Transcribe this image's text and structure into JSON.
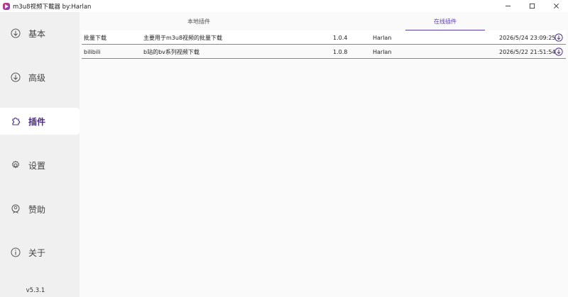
{
  "window": {
    "title": "m3u8视频下載器 by:Harlan",
    "controls": [
      "minimize-icon",
      "maximize-icon",
      "close-icon"
    ]
  },
  "sidebar": {
    "items": [
      {
        "label": "基本",
        "icon": "download-circle-icon",
        "active": false
      },
      {
        "label": "高级",
        "icon": "download-circle-icon",
        "active": false
      },
      {
        "label": "插件",
        "icon": "plugin-icon",
        "active": true
      },
      {
        "label": "设置",
        "icon": "gear-icon",
        "active": false
      },
      {
        "label": "赞助",
        "icon": "sponsor-icon",
        "active": false
      },
      {
        "label": "关于",
        "icon": "info-icon",
        "active": false
      }
    ],
    "version": "v5.3.1"
  },
  "tabs": [
    {
      "label": "本地插件",
      "active": false
    },
    {
      "label": "在线插件",
      "active": true
    }
  ],
  "plugins": [
    {
      "name": "批量下载",
      "description": "主要用于m3u8视频的批量下载",
      "version": "1.0.4",
      "author": "Harlan",
      "date": "2026/5/24 23:09:25",
      "icon": "download-icon"
    },
    {
      "name": "bilibili",
      "description": "b站的bv系列视频下载",
      "version": "1.0.8",
      "author": "Harlan",
      "date": "2026/5/22 21:51:54",
      "icon": "download-icon"
    }
  ],
  "colors": {
    "accent": "#5a3fa0",
    "sidebar_bg": "#f0f0f0",
    "main_bg": "#fafafa"
  }
}
